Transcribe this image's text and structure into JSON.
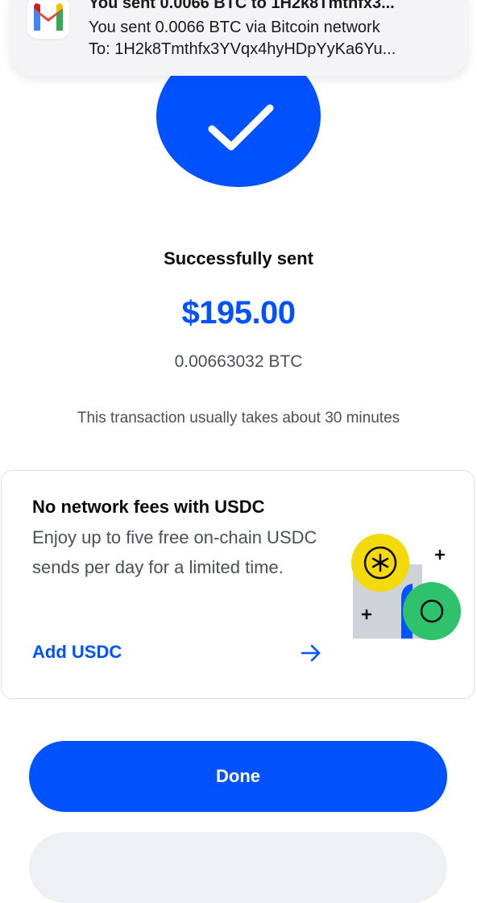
{
  "notification": {
    "app_icon": "gmail-icon",
    "title": "You sent 0.0066 BTC to 1H2k8Tmthfx3...",
    "line1": "You sent 0.0066 BTC via Bitcoin network",
    "line2": "To: 1H2k8Tmthfx3YVqx4hyHDpYyKa6Yu..."
  },
  "status": {
    "icon": "checkmark-icon",
    "title": "Successfully sent",
    "amount": "$195.00",
    "crypto_amount": "0.00663032 BTC",
    "eta_note": "This transaction usually takes about 30 minutes"
  },
  "promo": {
    "title": "No network fees with USDC",
    "body": "Enjoy up to five free on-chain USDC sends per day for a limited time.",
    "link_label": "Add USDC",
    "link_icon": "arrow-right-icon",
    "illustration": "usdc-illustration"
  },
  "actions": {
    "done_label": "Done"
  },
  "colors": {
    "brand_blue": "#0052ff",
    "text_primary": "#0a0b0d",
    "text_secondary": "#4a4f59",
    "accent_yellow": "#f4d90b",
    "accent_green": "#2ec26c"
  }
}
